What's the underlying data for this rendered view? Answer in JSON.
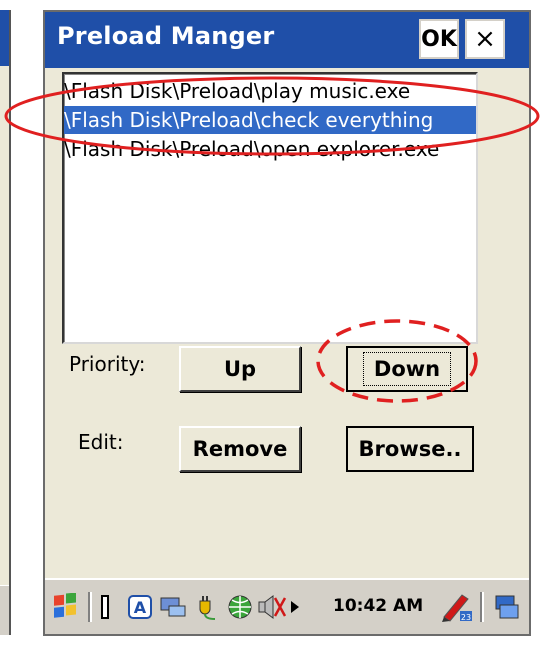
{
  "window": {
    "title": "Preload Manger",
    "ok_label": "OK",
    "close_label": "×"
  },
  "preload_list": {
    "items": [
      {
        "label": "\\Flash Disk\\Preload\\play music.exe",
        "selected": false
      },
      {
        "label": "\\Flash Disk\\Preload\\check everything",
        "selected": true
      },
      {
        "label": "\\Flash Disk\\Preload\\open explorer.exe",
        "selected": false
      }
    ]
  },
  "priority": {
    "label": "Priority:",
    "up_label": "Up",
    "down_label": "Down"
  },
  "edit": {
    "label": "Edit:",
    "remove_label": "Remove",
    "browse_label": "Browse.."
  },
  "taskbar": {
    "clock": "10:42 AM",
    "icons": [
      "start-icon",
      "input-panel-icon",
      "ime-a-icon",
      "network-icon",
      "power-plug-icon",
      "globe-icon",
      "speaker-muted-icon",
      "arrow-right-icon",
      "calendar-pen-icon",
      "desktop-icon"
    ]
  },
  "colors": {
    "titlebar": "#1f4fa8",
    "selection": "#3169c6",
    "annotation": "#e02020"
  }
}
